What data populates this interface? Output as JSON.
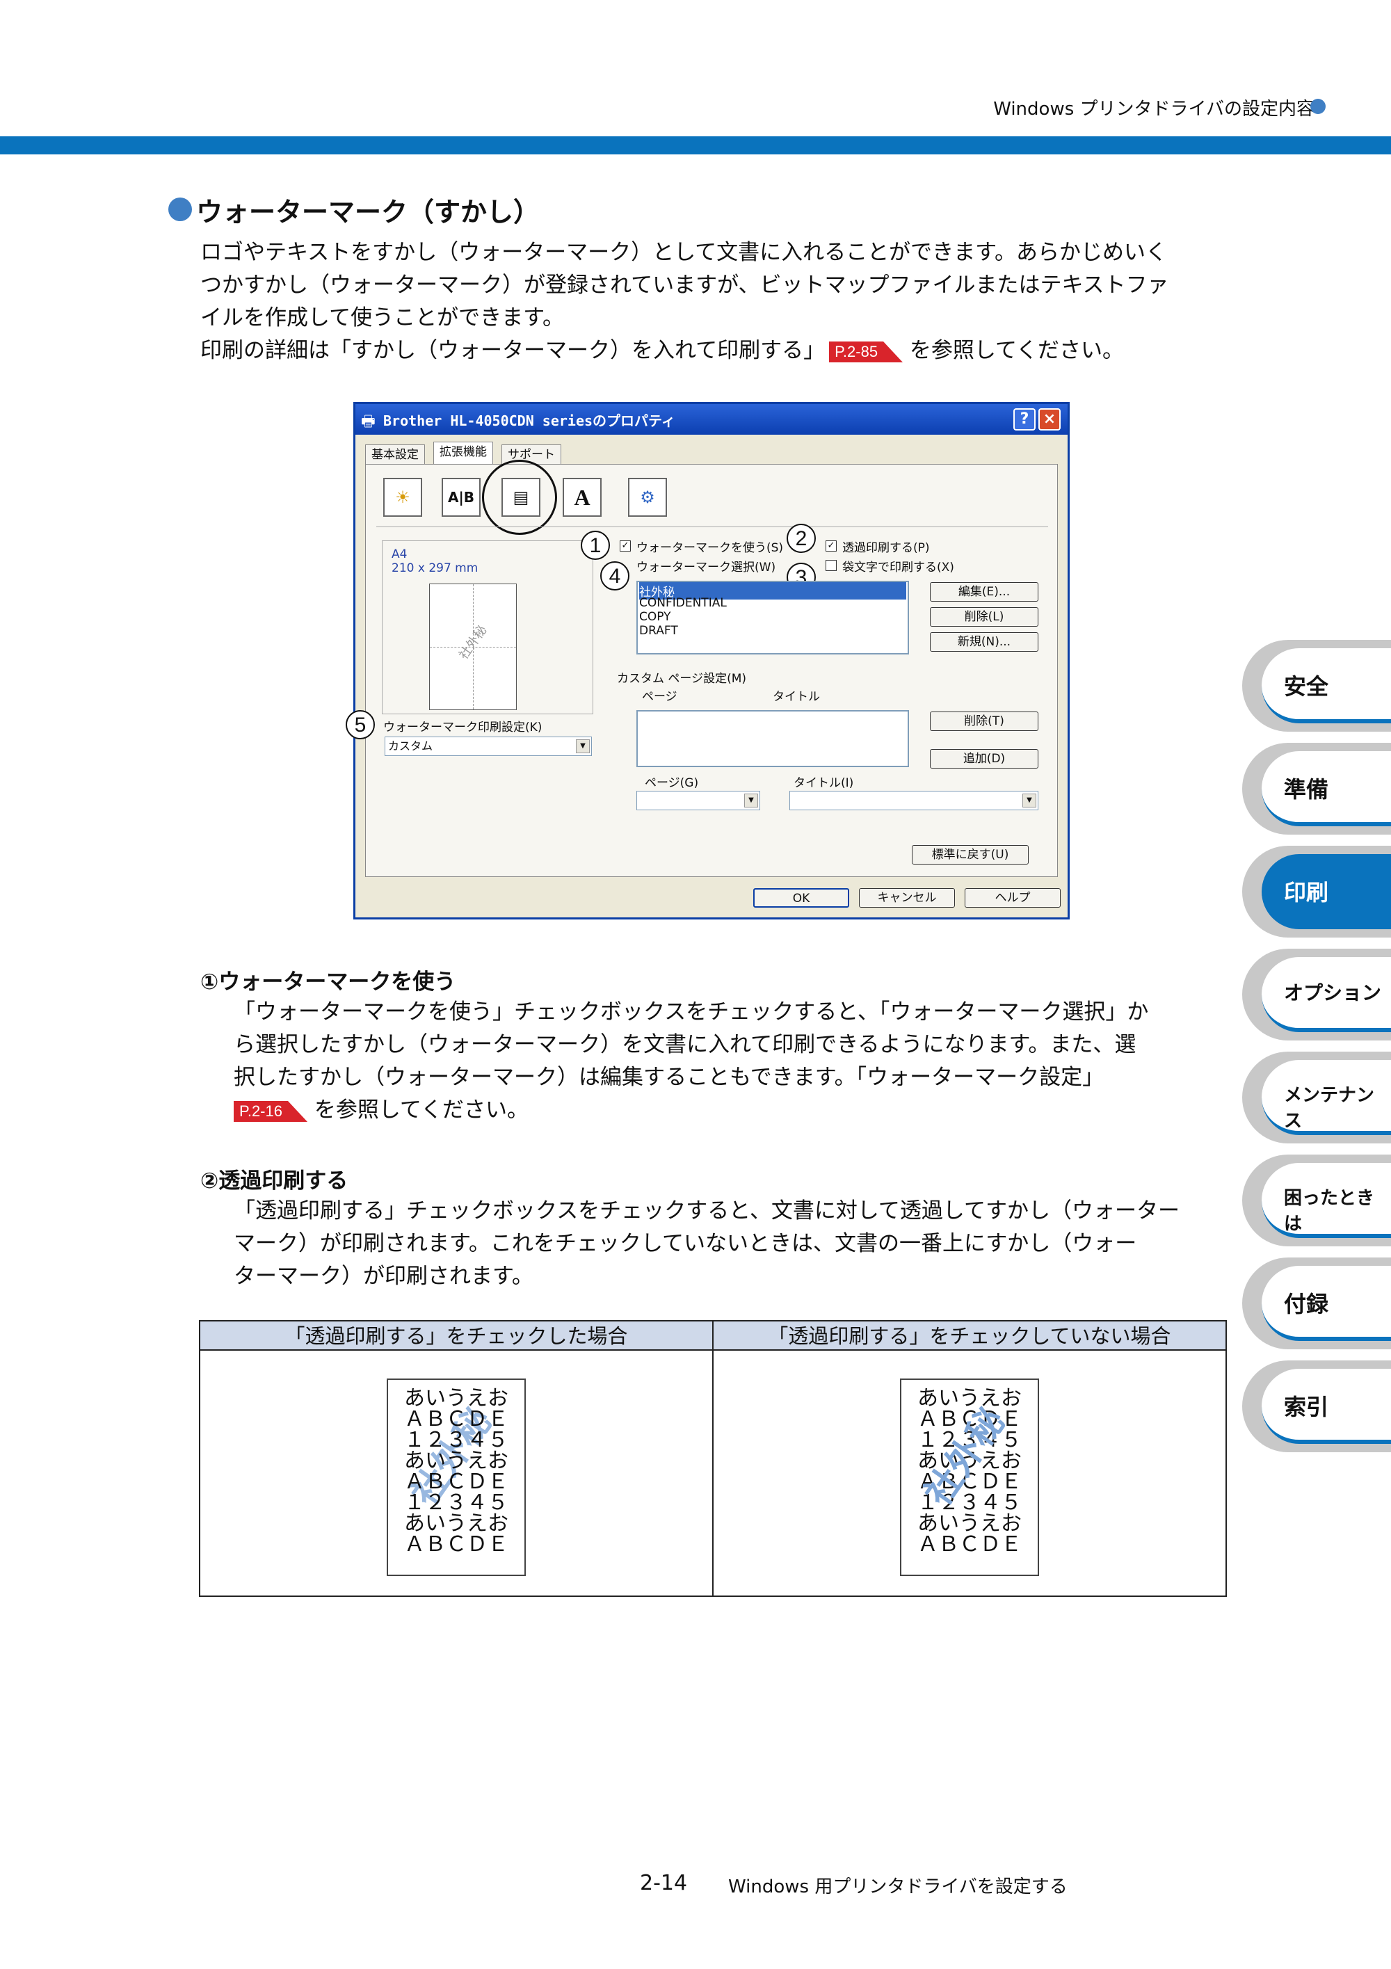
{
  "header": {
    "running_title": "Windows プリンタドライバの設定内容"
  },
  "section": {
    "title": "ウォーターマーク（すかし）",
    "para_lines": [
      "ロゴやテキストをすかし（ウォーターマーク）として文書に入れることができます。あらかじめいく",
      "つかすかし（ウォーターマーク）が登録されていますが、ビットマップファイルまたはテキストファ",
      "イルを作成して使うことができます。"
    ],
    "ref_pre": "印刷の詳細は「すかし（ウォーターマーク）を入れて印刷する」",
    "ref_badge": "P.2-85",
    "ref_post": "を参照してください。"
  },
  "dialog": {
    "title": "Brother HL-4050CDN seriesのプロパティ",
    "help_btn": "?",
    "close_btn": "×",
    "tabs": [
      "基本設定",
      "拡張機能",
      "サポート"
    ],
    "icons": [
      "sun-icon",
      "ab-icon",
      "copy-icon",
      "font-icon",
      "tools-icon"
    ],
    "icon_glyphs": [
      "☀",
      "A|B",
      "▤",
      "A",
      "⚙"
    ],
    "paper_size": "A4",
    "paper_dims": "210 x 297 mm",
    "use_watermark": "ウォーターマークを使う(S)",
    "transparent": "透過印刷する(P)",
    "select_label": "ウォーターマーク選択(W)",
    "outline": "袋文字で印刷する(X)",
    "watermarks": [
      "社外秘",
      "CONFIDENTIAL",
      "COPY",
      "DRAFT"
    ],
    "edit_btn": "編集(E)...",
    "delete_btn": "削除(L)",
    "new_btn": "新規(N)...",
    "custom_label": "カスタム ページ設定(M)",
    "col_page": "ページ",
    "col_title": "タイトル",
    "delete2_btn": "削除(T)",
    "add_btn": "追加(D)",
    "page_combo_label": "ページ(G)",
    "title_combo_label": "タイトル(I)",
    "print_setting_label": "ウォーターマーク印刷設定(K)",
    "print_setting_value": "カスタム",
    "default_btn": "標準に戻す(U)",
    "ok_btn": "OK",
    "cancel_btn": "キャンセル",
    "help2_btn": "ヘルプ",
    "callouts": [
      "1",
      "2",
      "3",
      "4",
      "5"
    ],
    "preview_wm": "社外秘"
  },
  "side_tabs": [
    "安全",
    "準備",
    "印刷",
    "オプション",
    "メンテナンス",
    "困ったときは",
    "付録",
    "索引"
  ],
  "item1": {
    "heading": "①ウォーターマークを使う",
    "lines": [
      "「ウォーターマークを使う」チェックボックスをチェックすると、「ウォーターマーク選択」か",
      "ら選択したすかし（ウォーターマーク）を文書に入れて印刷できるようになります。また、選",
      "択したすかし（ウォーターマーク）は編集することもできます。「ウォーターマーク設定」"
    ],
    "ref_badge": "P.2-16",
    "ref_post": "を参照してください。"
  },
  "item2": {
    "heading": "②透過印刷する",
    "lines": [
      "「透過印刷する」チェックボックスをチェックすると、文書に対して透過してすかし（ウォーター",
      "マーク）が印刷されます。これをチェックしていないときは、文書の一番上にすかし（ウォー",
      "ターマーク）が印刷されます。"
    ]
  },
  "compare": {
    "col1": "「透過印刷する」をチェックした場合",
    "col2": "「透過印刷する」をチェックしていない場合",
    "sample_lines": [
      "あいうえお",
      "ＡＢＣＤＥ",
      "１２３４５",
      "あいうえお",
      "ＡＢＣＤＥ",
      "１２３４５",
      "あいうえお",
      "ＡＢＣＤＥ"
    ],
    "wm_text": "社外秘"
  },
  "footer": {
    "page_number": "2-14",
    "title": "Windows 用プリンタドライバを設定する"
  }
}
